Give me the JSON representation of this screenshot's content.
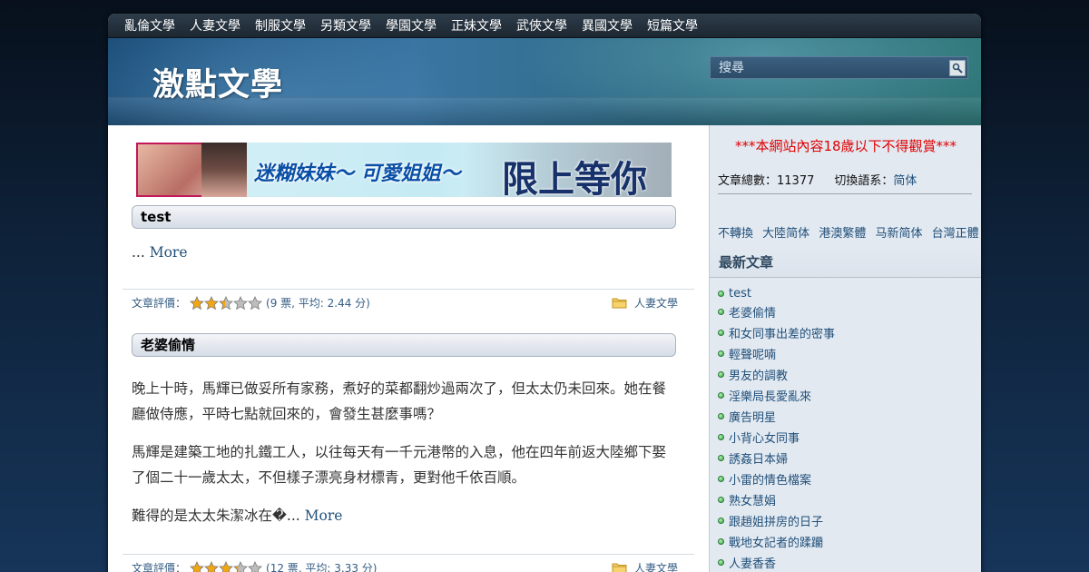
{
  "nav": {
    "items": [
      "亂倫文學",
      "人妻文學",
      "制服文學",
      "另類文學",
      "學園文學",
      "正妹文學",
      "武俠文學",
      "異國文學",
      "短篇文學"
    ]
  },
  "header": {
    "site_title": "激點文學",
    "search_placeholder": "搜尋"
  },
  "banner": {
    "text_a": "迷糊妹妹～ 可愛姐姐～",
    "text_b": "限上等你"
  },
  "posts": [
    {
      "title": "test",
      "excerpt": [
        "..."
      ],
      "more": "More",
      "rating_label": "文章評價：",
      "rating": 2.44,
      "rating_text": "(9 票, 平均: 2.44 分)",
      "category": "人妻文學"
    },
    {
      "title": "老婆偷情",
      "excerpt": [
        "晚上十時，馬輝已做妥所有家務，煮好的菜都翻炒過兩次了，但太太仍未回來。她在餐廳做侍應，平時七點就回來的，會發生甚麼事嗎？",
        "馬輝是建築工地的扎鐵工人，以往每天有一千元港幣的入息，他在四年前返大陸鄉下娶了個二十一歲太太，不但樣子漂亮身材標青，更對他千依百順。",
        "難得的是太太朱潔冰在�..."
      ],
      "more": "More",
      "rating_label": "文章評價：",
      "rating": 3.33,
      "rating_text": "(12 票, 平均: 3.33 分)",
      "category": "人妻文學"
    }
  ],
  "sidebar": {
    "warning": "***本網站內容18歲以下不得觀賞***",
    "total_label": "文章總數：",
    "total": "11377",
    "switch_label": "切換語系：",
    "switch_value": "简体",
    "variants": [
      "不轉換",
      "大陸简体",
      "港澳繁體",
      "马新简体",
      "台灣正體"
    ],
    "latest_heading": "最新文章",
    "latest": [
      "test",
      "老婆偷情",
      "和女同事出差的密事",
      "輕聲呢喃",
      "男友的調教",
      "淫樂局長愛亂來",
      "廣告明星",
      "小背心女同事",
      "誘姦日本婦",
      "小雷的情色檔案",
      "熟女慧娟",
      "跟趙姐拼房的日子",
      "戰地女記者的蹂躪",
      "人妻香香"
    ]
  },
  "colors": {
    "link": "#21507a",
    "warning": "#e00000",
    "star_fill": "#f2a611"
  },
  "icons": {
    "search": "magnifier-icon",
    "category": "folder-icon",
    "rating": "star-icon",
    "list_bullet": "green-dot-icon"
  }
}
